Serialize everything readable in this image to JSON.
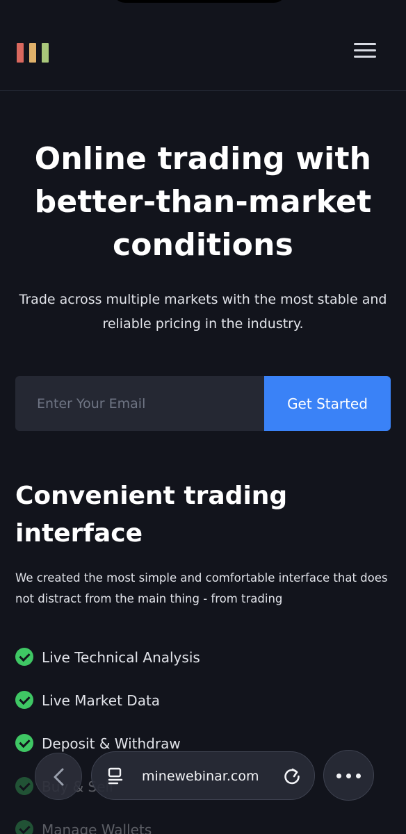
{
  "header": {
    "logo": "three-bar-logo",
    "menu_icon": "hamburger-menu-icon"
  },
  "hero": {
    "title": "Online trading with better-than-market conditions",
    "subtitle": "Trade across multiple markets with the most stable and reliable pricing in the industry."
  },
  "signup": {
    "email_placeholder": "Enter Your Email",
    "email_value": "",
    "button_label": "Get Started"
  },
  "section": {
    "title": "Convenient trading interface",
    "description": "We created the most simple and comfortable interface that does not distract from the main thing - from trading",
    "features": [
      {
        "label": "Live Technical Analysis"
      },
      {
        "label": "Live Market Data"
      },
      {
        "label": "Deposit & Withdraw"
      },
      {
        "label": "Buy & Sell"
      },
      {
        "label": "Manage Wallets"
      }
    ]
  },
  "browser": {
    "url": "minewebinar.com",
    "back_icon": "chevron-left-icon",
    "tab_icon": "tabs-icon",
    "reload_icon": "reload-icon",
    "more_icon": "more-dots-icon"
  },
  "colors": {
    "background": "#12141c",
    "accent": "#3a82f7",
    "check": "#3fc764",
    "logo_bars": [
      "#d9685e",
      "#e0b16a",
      "#a9c77a"
    ]
  }
}
